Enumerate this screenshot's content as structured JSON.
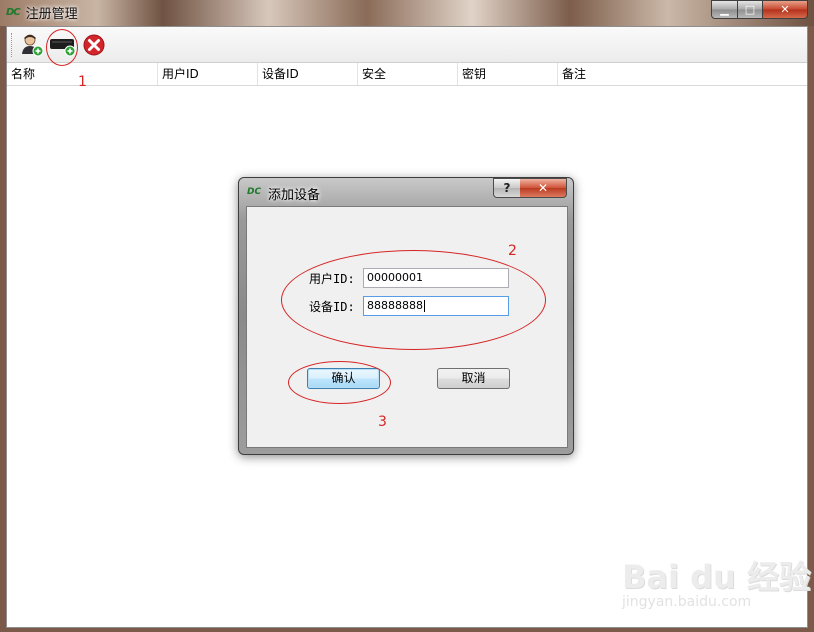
{
  "window": {
    "logo_text": "DC",
    "title": "注册管理",
    "min_label": "▁",
    "max_label": "□",
    "close_label": "✕"
  },
  "toolbar": {
    "buttons": [
      {
        "name": "add-user",
        "icon": "user-add-icon"
      },
      {
        "name": "add-device",
        "icon": "device-add-icon"
      },
      {
        "name": "delete",
        "icon": "delete-icon"
      }
    ]
  },
  "table": {
    "columns": [
      "名称",
      "用户ID",
      "设备ID",
      "安全",
      "密钥",
      "备注"
    ],
    "rows": []
  },
  "dialog": {
    "logo_text": "DC",
    "title": "添加设备",
    "help_label": "?",
    "close_label": "✕",
    "user_id_label": "用户ID:",
    "user_id_value": "00000001",
    "device_id_label": "设备ID:",
    "device_id_value": "88888888",
    "confirm_label": "确认",
    "cancel_label": "取消"
  },
  "annotations": {
    "step1": "1",
    "step2": "2",
    "step3": "3",
    "color": "#d62424"
  },
  "watermark": {
    "brand": "Bai du 经验",
    "url": "jingyan.baidu.com"
  }
}
